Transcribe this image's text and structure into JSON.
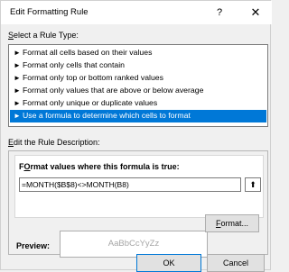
{
  "window": {
    "title": "Edit Formatting Rule",
    "help_label": "?",
    "close_label": "✕"
  },
  "rule_type": {
    "label_prefix": "",
    "label_underlined": "S",
    "label_rest": "elect a Rule Type:",
    "items": [
      {
        "label": "Format all cells based on their values",
        "selected": false
      },
      {
        "label": "Format only cells that contain",
        "selected": false
      },
      {
        "label": "Format only top or bottom ranked values",
        "selected": false
      },
      {
        "label": "Format only values that are above or below average",
        "selected": false
      },
      {
        "label": "Format only unique or duplicate values",
        "selected": false
      },
      {
        "label": "Use a formula to determine which cells to format",
        "selected": true
      }
    ],
    "bullet": "►"
  },
  "rule_description": {
    "label_underlined": "E",
    "label_rest": "dit the Rule Description:",
    "format_values_underlined": "O",
    "format_values_prefix": "F",
    "format_values_rest": "rmat values where this formula is true:",
    "formula": "=MONTH($B$8)<>MONTH(B8)",
    "collapse_icon": "⬆",
    "preview_label": "Preview:",
    "preview_text": "AaBbCcYyZz",
    "format_button_prefix": "",
    "format_button_underlined": "F",
    "format_button_rest": "ormat..."
  },
  "footer": {
    "ok_label": "OK",
    "cancel_label": "Cancel"
  },
  "colors": {
    "selection": "#0078d7",
    "dialog_bg": "#f0f0f0"
  }
}
